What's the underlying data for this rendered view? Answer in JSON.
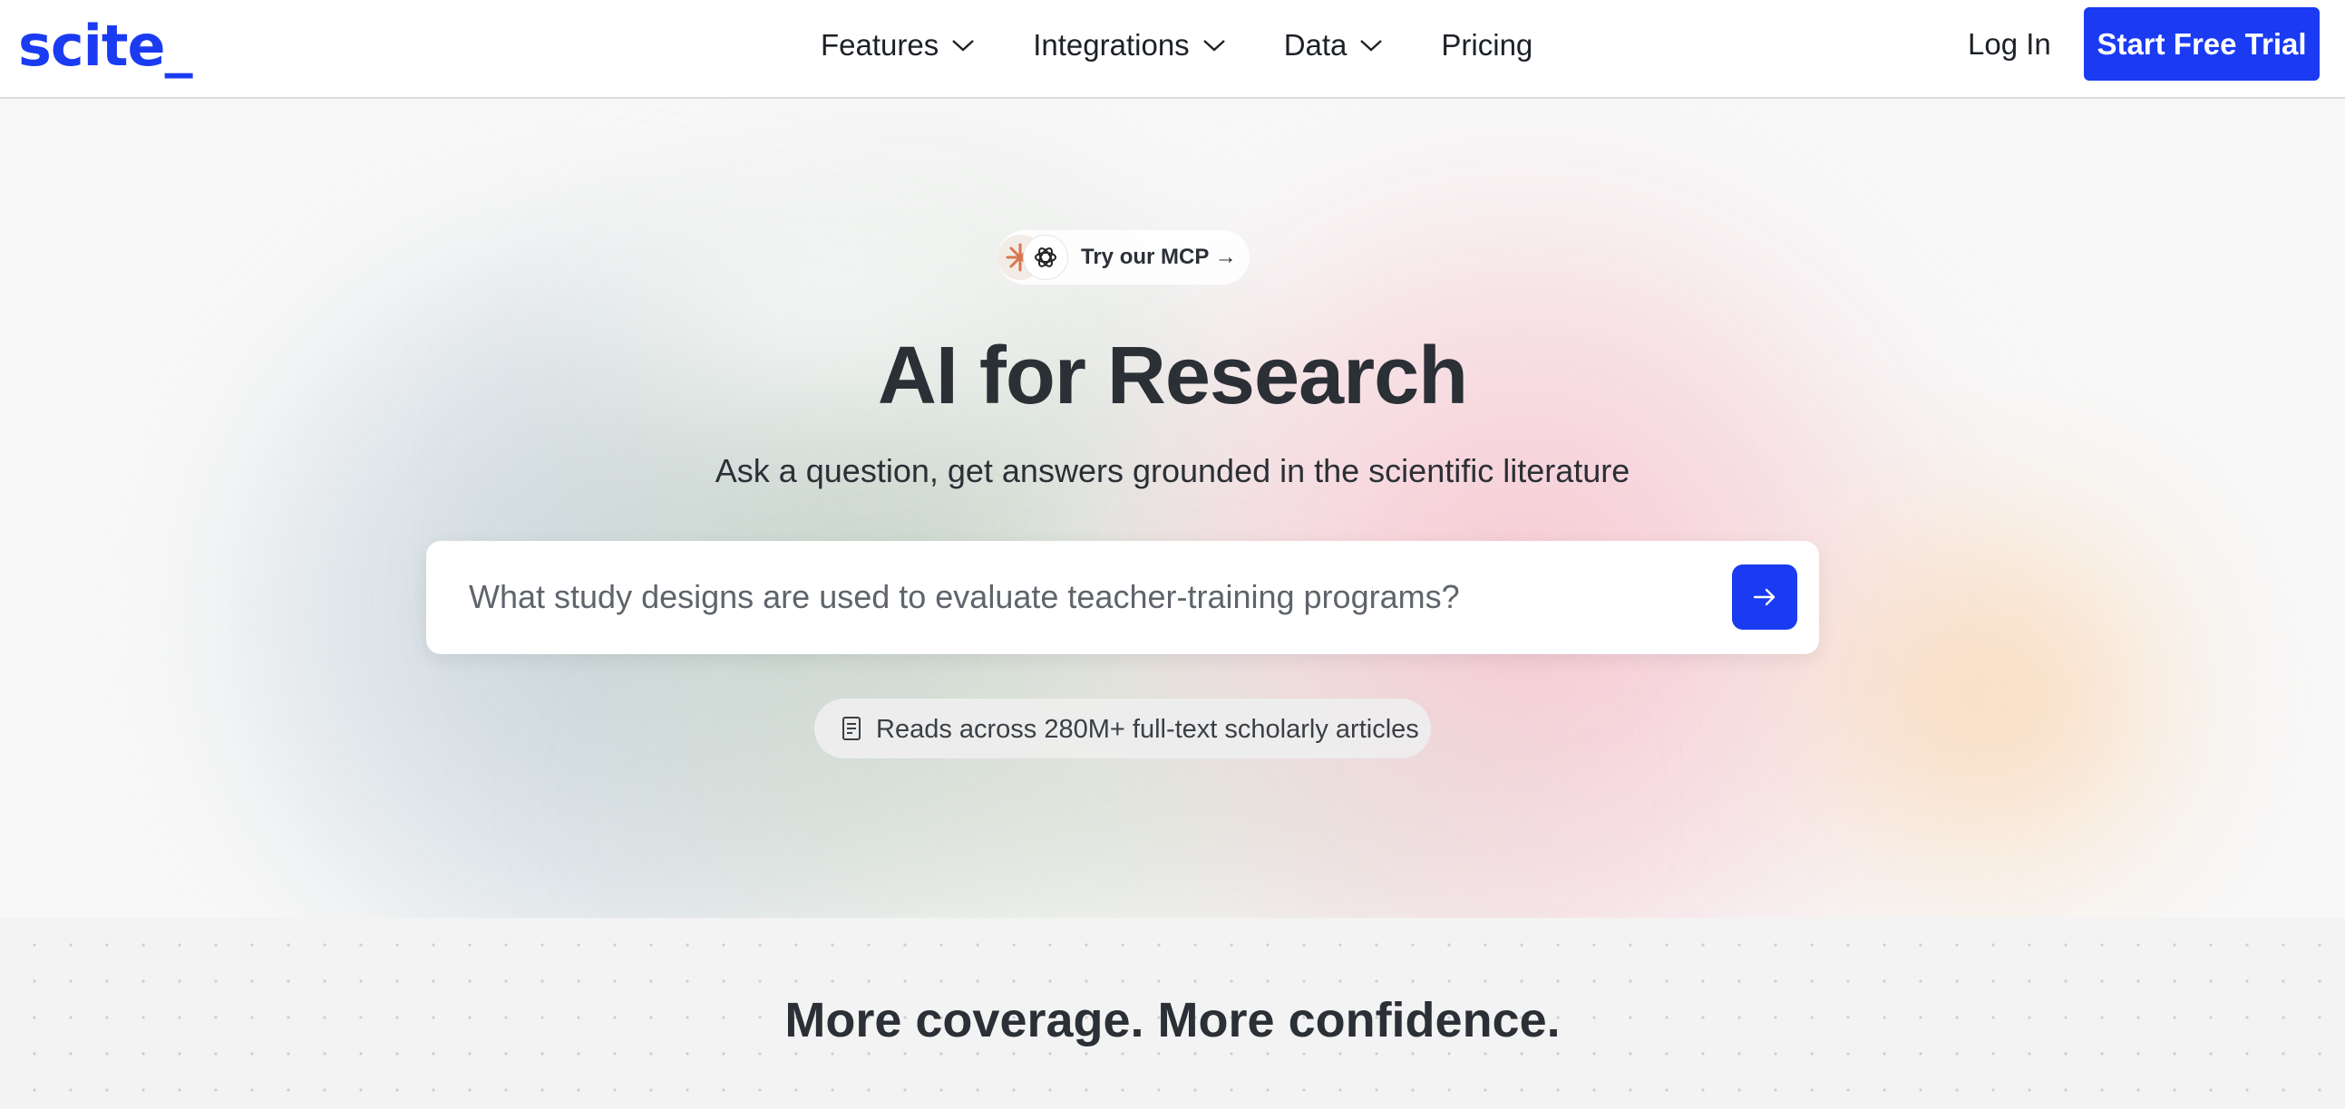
{
  "brand": {
    "logo_text": "scite_",
    "accent_color": "#1a3bf2"
  },
  "nav": {
    "items": [
      {
        "label": "Features",
        "has_dropdown": true
      },
      {
        "label": "Integrations",
        "has_dropdown": true
      },
      {
        "label": "Data",
        "has_dropdown": true
      },
      {
        "label": "Pricing",
        "has_dropdown": false
      }
    ],
    "login_label": "Log In",
    "cta_label": "Start Free Trial"
  },
  "hero": {
    "mcp_pill": {
      "label": "Try our MCP →",
      "icons": [
        "claude-icon",
        "openai-icon"
      ]
    },
    "title": "AI for Research",
    "subtitle": "Ask a question, get answers grounded in the scientific literature",
    "search": {
      "placeholder": "What study designs are used to evaluate teacher-training programs?",
      "submit_icon": "arrow-right-icon"
    },
    "stats": {
      "icon": "document-icon",
      "text": "Reads across 280M+ full-text scholarly articles"
    }
  },
  "section2": {
    "title": "More coverage. More confidence."
  }
}
